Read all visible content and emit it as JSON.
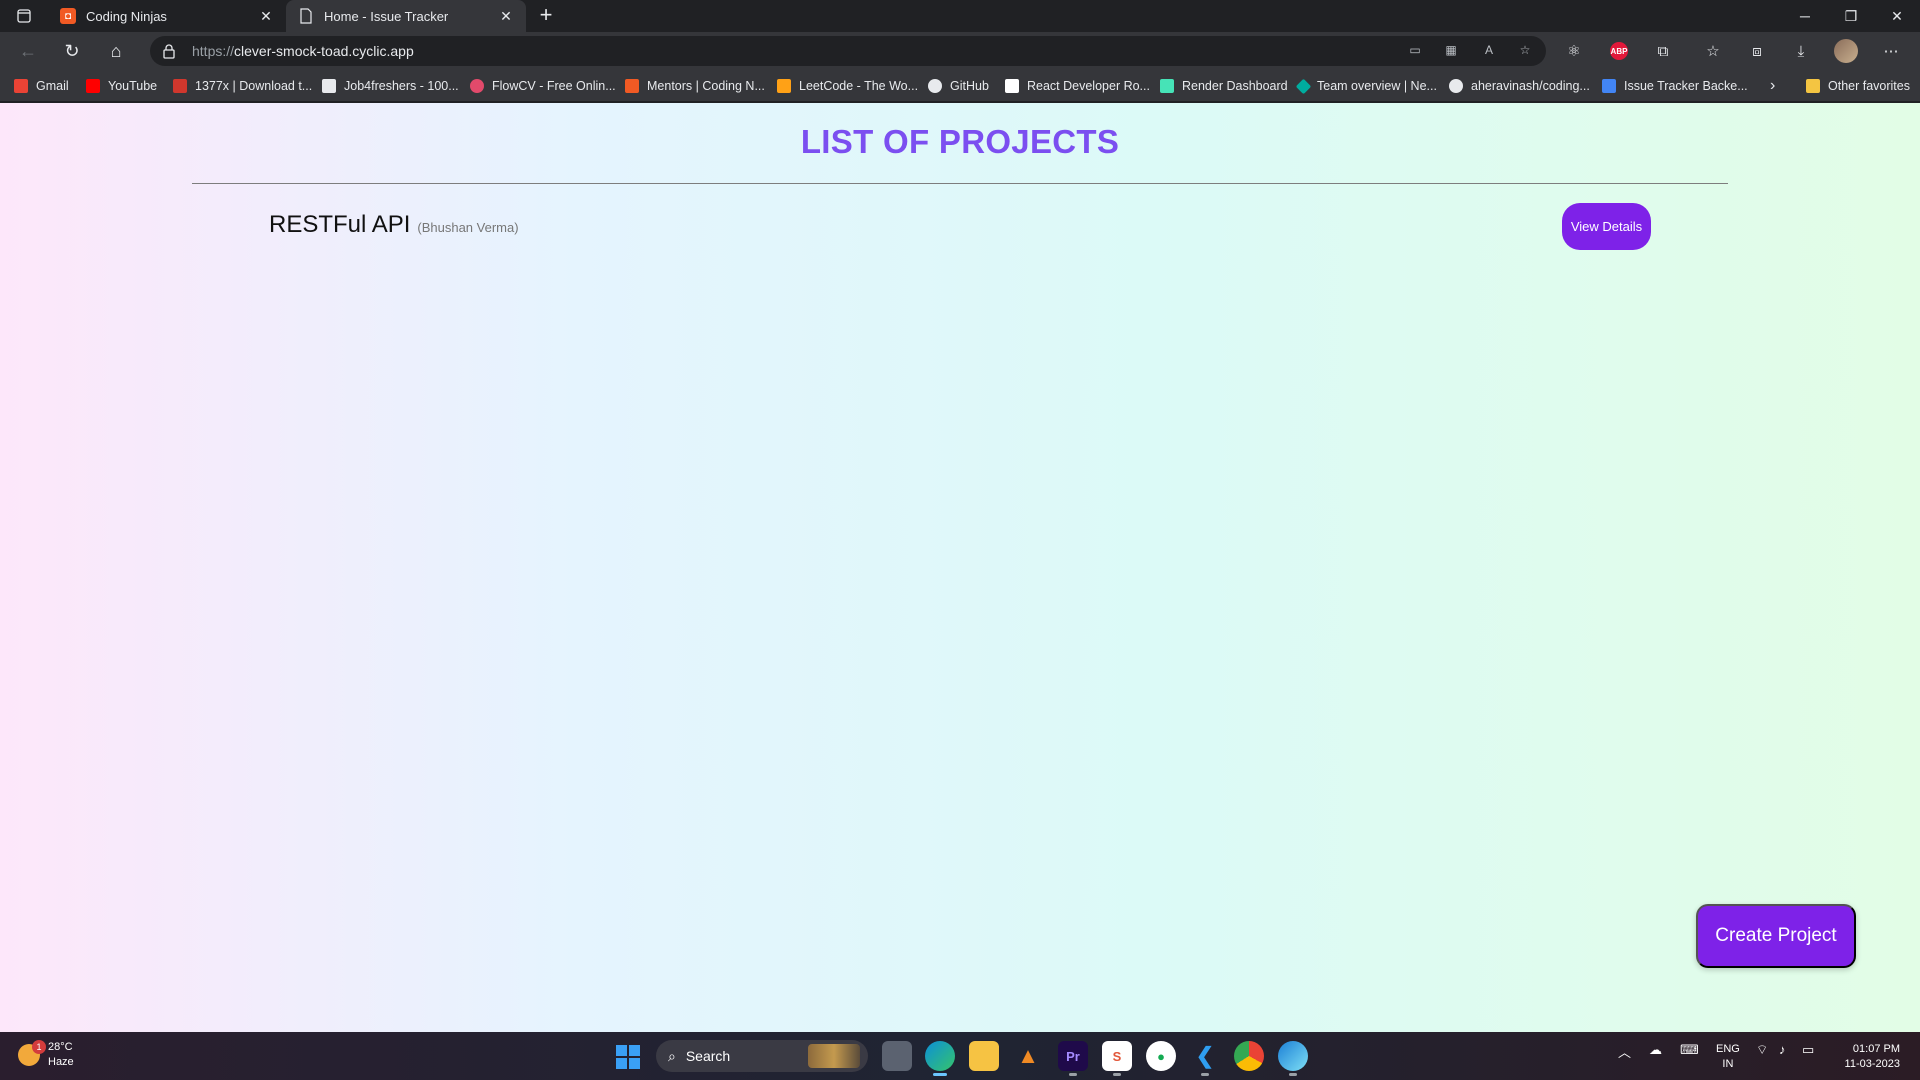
{
  "browser": {
    "tabs": [
      {
        "title": "Coding Ninjas",
        "active": false
      },
      {
        "title": "Home - Issue Tracker",
        "active": true
      }
    ],
    "address": {
      "scheme": "https://",
      "host": "clever-smock-toad.cyclic.app"
    },
    "bookmarks": [
      {
        "label": "Gmail",
        "color": "#ea4335"
      },
      {
        "label": "YouTube",
        "color": "#ff0000"
      },
      {
        "label": "1377x | Download t...",
        "color": "#d0372d"
      },
      {
        "label": "Job4freshers - 100...",
        "color": "#e8eaed"
      },
      {
        "label": "FlowCV - Free Onlin...",
        "color": "#e24a6b"
      },
      {
        "label": "Mentors | Coding N...",
        "color": "#f15a24"
      },
      {
        "label": "LeetCode - The Wo...",
        "color": "#ffa116"
      },
      {
        "label": "GitHub",
        "color": "#e8eaed"
      },
      {
        "label": "React Developer Ro...",
        "color": "#ffffff"
      },
      {
        "label": "Render Dashboard",
        "color": "#46e3b7"
      },
      {
        "label": "Team overview | Ne...",
        "color": "#00ad9f"
      },
      {
        "label": "aheravinash/coding...",
        "color": "#e8eaed"
      },
      {
        "label": "Issue Tracker Backe...",
        "color": "#4285f4"
      }
    ],
    "other_favorites": "Other favorites"
  },
  "page": {
    "title": "LIST OF PROJECTS",
    "projects": [
      {
        "name": "RESTFul API",
        "owner": "(Bhushan Verma)",
        "action": "View Details"
      }
    ],
    "create_button": "Create Project"
  },
  "taskbar": {
    "weather": {
      "temp": "28°C",
      "condition": "Haze",
      "badge": "1"
    },
    "search_label": "Search",
    "lang": {
      "line1": "ENG",
      "line2": "IN"
    },
    "time": "01:07 PM",
    "date": "11-03-2023"
  }
}
